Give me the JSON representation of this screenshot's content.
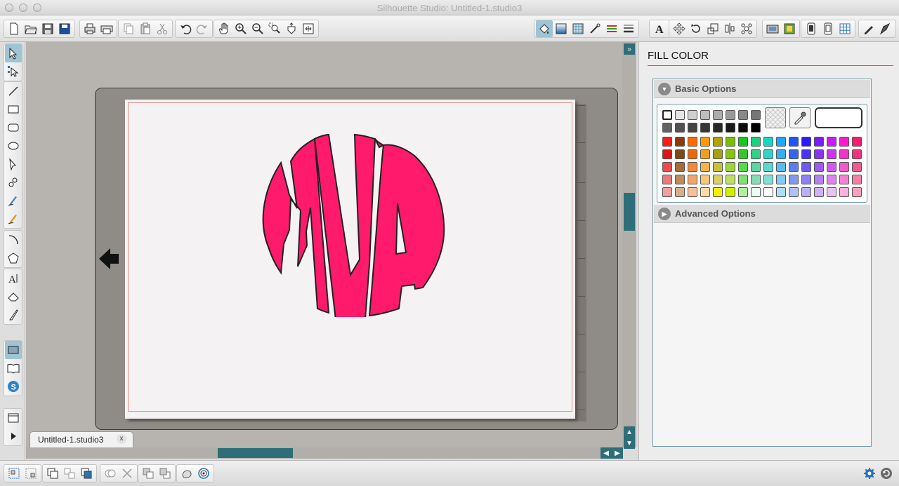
{
  "window": {
    "title": "Silhouette Studio: Untitled-1.studio3"
  },
  "toolbar": {
    "file_tools": [
      "new-icon",
      "open-icon",
      "save-icon",
      "save-to-library-icon"
    ],
    "print_tools": [
      "print-icon",
      "send-to-cutter-icon"
    ],
    "edit_tools": [
      "copy-icon",
      "paste-icon",
      "cut-icon"
    ],
    "undo_tools": [
      "undo-icon",
      "redo-icon"
    ],
    "view_tools": [
      "pan-icon",
      "zoom-in-icon",
      "zoom-out-icon",
      "zoom-select-icon",
      "drag-zoom-icon",
      "fit-to-page-icon"
    ],
    "right_tools": [
      "fill-color-icon",
      "fill-gradient-icon",
      "fill-pattern-icon",
      "line-style-icon",
      "line-color-icon",
      "line-weight-icon",
      "text-style-icon",
      "move-icon",
      "rotate-icon",
      "scale-icon",
      "align-icon",
      "replicate-icon",
      "library-icon",
      "store-icon",
      "page-setup-icon",
      "cut-settings-icon",
      "grid-icon",
      "sketch-icon",
      "trace-icon"
    ]
  },
  "left_tools": {
    "select": [
      "select-icon",
      "edit-points-icon"
    ],
    "draw": [
      "line-icon",
      "rectangle-icon",
      "rounded-rectangle-icon",
      "ellipse-icon",
      "polygon-icon",
      "curve-icon",
      "freehand-icon",
      "smooth-freehand-icon"
    ],
    "shapes": [
      "arc-icon",
      "regular-polygon-icon"
    ],
    "text": [
      "text-icon",
      "eraser-icon",
      "knife-icon"
    ],
    "library": [
      "shapes-library-icon",
      "library-book-icon",
      "silhouette-store-icon"
    ],
    "misc": [
      "window-icon",
      "play-icon"
    ]
  },
  "document": {
    "tab_label": "Untitled-1.studio3",
    "tab_close": "x",
    "design_text": "MVA",
    "design_fill": "#ff1a6c"
  },
  "panel": {
    "title": "FILL COLOR",
    "basic_options_label": "Basic Options",
    "advanced_options_label": "Advanced Options",
    "accent_color": "#2e6e79",
    "gray_row_1": [
      "#ffffff",
      "#e4e4e4",
      "#cfcfcf",
      "#bdbdbd",
      "#ababab",
      "#9a9a9a",
      "#888888",
      "#767676"
    ],
    "gray_row_2": [
      "#626262",
      "#525252",
      "#444444",
      "#363636",
      "#282828",
      "#1a1a1a",
      "#0d0d0d",
      "#000000"
    ],
    "color_rows": [
      [
        "#ff1a1a",
        "#8b3a0a",
        "#ff6a00",
        "#ff9c00",
        "#b5a200",
        "#7ac000",
        "#14c91e",
        "#17d27e",
        "#17d6c2",
        "#1aa9ff",
        "#1a55ff",
        "#2a1aff",
        "#7b1aff",
        "#cc1aff",
        "#ff1ad0",
        "#ff1a6c"
      ],
      [
        "#e01414",
        "#7a4a1a",
        "#e86a10",
        "#f0a020",
        "#a8a014",
        "#88c414",
        "#34c82a",
        "#34d08a",
        "#34d2c4",
        "#34aef0",
        "#3466f0",
        "#4a34f0",
        "#8a34f0",
        "#cc34f0",
        "#f034c8",
        "#f0347a"
      ],
      [
        "#f04848",
        "#a86a3a",
        "#f08a3a",
        "#f4b44a",
        "#c8c03a",
        "#a0d43a",
        "#5ad84a",
        "#5ad89e",
        "#5ad8cc",
        "#5abcf0",
        "#5a80f0",
        "#6e5af0",
        "#a05af0",
        "#d05af0",
        "#f05ac8",
        "#f05a8e"
      ],
      [
        "#f07878",
        "#c08a5a",
        "#f4a468",
        "#f8c878",
        "#d8d060",
        "#bce060",
        "#80e070",
        "#80e0b4",
        "#80e0d8",
        "#80ccf4",
        "#8098f4",
        "#8e80f4",
        "#b480f4",
        "#dc80f4",
        "#f480d4",
        "#f480a8"
      ],
      [
        "#f0a0a0",
        "#d4b090",
        "#f8c098",
        "#fcdca4",
        "#f4f000",
        "#d0f000",
        "#b0f0a0",
        "#e8fff0",
        "#ffffff",
        "#a8e0f8",
        "#b0c0f8",
        "#b8b0f8",
        "#d0b0f8",
        "#ecc0f8",
        "#f8b0e0",
        "#f8a0c0"
      ]
    ]
  },
  "bottom_tools": {
    "group_1": [
      "group-icon",
      "ungroup-icon"
    ],
    "group_2": [
      "make-compound-icon",
      "release-compound-icon",
      "bring-to-front-icon"
    ],
    "group_3": [
      "weld-icon",
      "delete-icon"
    ],
    "group_4": [
      "send-backward-icon",
      "bring-forward-icon"
    ],
    "group_5": [
      "offset-icon",
      "trace-target-icon"
    ],
    "right": [
      "settings-gear-icon",
      "refresh-icon"
    ]
  }
}
